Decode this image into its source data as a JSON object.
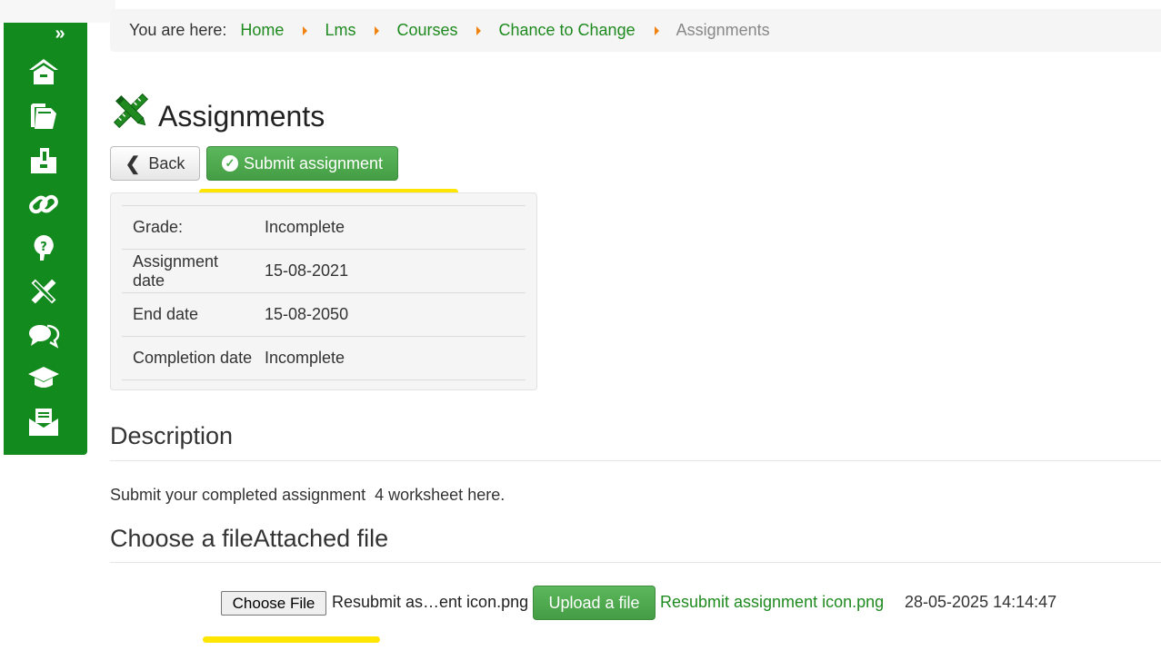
{
  "colors": {
    "brand": "#128a1e",
    "link": "#1f8a1f",
    "separator": "#f0820f",
    "success": "#5cb85c",
    "highlight": "#ffe600"
  },
  "sidebar": {
    "expand_label": "»",
    "items": [
      {
        "icon": "home-icon"
      },
      {
        "icon": "documents-icon"
      },
      {
        "icon": "modules-icon"
      },
      {
        "icon": "link-icon"
      },
      {
        "icon": "help-icon"
      },
      {
        "icon": "assignment-icon"
      },
      {
        "icon": "chat-icon"
      },
      {
        "icon": "graduation-cap-icon"
      },
      {
        "icon": "mail-icon"
      }
    ]
  },
  "breadcrumb": {
    "label": "You are here:",
    "links": [
      "Home",
      "Lms",
      "Courses",
      "Chance to Change"
    ],
    "current": "Assignments"
  },
  "page": {
    "title": "Assignments",
    "icon": "pencil-ruler-icon"
  },
  "toolbar": {
    "back_label": "Back",
    "submit_label": "Submit assignment"
  },
  "info": {
    "rows": [
      {
        "label": "Grade:",
        "value": "Incomplete"
      },
      {
        "label": "Assignment date",
        "value": "15-08-2021"
      },
      {
        "label": "End date",
        "value": "15-08-2050"
      },
      {
        "label": "Completion date",
        "value": "Incomplete"
      }
    ]
  },
  "description": {
    "heading": "Description",
    "text": "Submit your completed assignment  4 worksheet here."
  },
  "file_section": {
    "heading": "Choose a fileAttached file",
    "choose_label": "Choose File",
    "selected_file": "Resubmit as…ent icon.png",
    "upload_label": "Upload a file",
    "attached_file": "Resubmit assignment icon.png",
    "attached_date": "28-05-2025 14:14:47"
  }
}
